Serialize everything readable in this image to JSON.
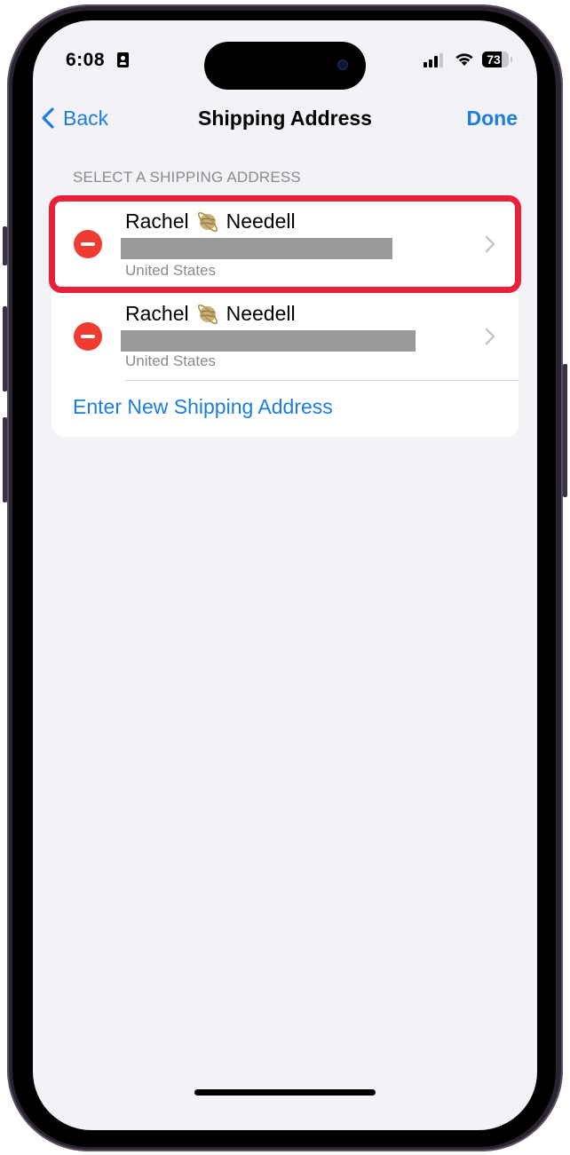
{
  "status_bar": {
    "time": "6:08",
    "battery_percent": "73",
    "battery_level": 0.73,
    "icons": [
      "contact-card-icon",
      "cellular-signal-icon",
      "wifi-icon",
      "battery-icon"
    ]
  },
  "nav": {
    "back_label": "Back",
    "title": "Shipping Address",
    "done_label": "Done"
  },
  "section_header": "SELECT A SHIPPING ADDRESS",
  "addresses": [
    {
      "first_name": "Rachel",
      "emoji": "ringed-planet",
      "last_name": "Needell",
      "street_redacted": true,
      "country": "United States",
      "highlighted": true
    },
    {
      "first_name": "Rachel",
      "emoji": "ringed-planet",
      "last_name": "Needell",
      "street_redacted": true,
      "country": "United States",
      "highlighted": false
    }
  ],
  "enter_new_label": "Enter New Shipping Address",
  "colors": {
    "accent": "#1a7ee0",
    "delete": "#ef3b30",
    "highlight": "#e8203a",
    "background": "#f2f2f7",
    "secondary_text": "#8a8a8e"
  }
}
